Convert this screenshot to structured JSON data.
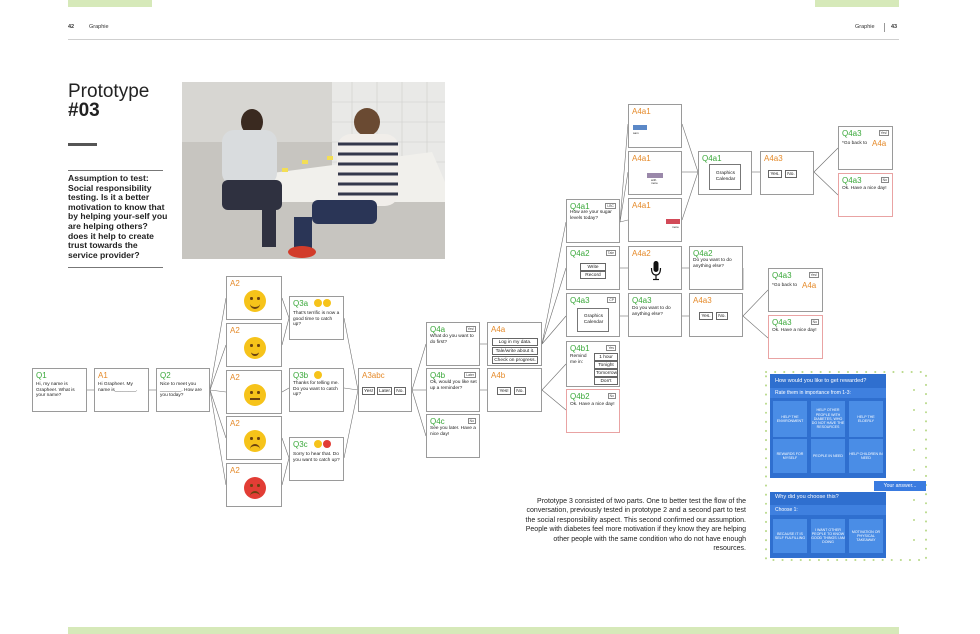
{
  "header": {
    "left_page_num": "42",
    "left_section": "Graphie",
    "right_section": "Graphie",
    "right_page_num": "43"
  },
  "prototype": {
    "title_line1": "Prototype",
    "title_line2": "#03",
    "assumption": "Assumption to test: Social responsibility testing. Is it a better motivation to know that by helping your-self you are helping others? does it help to create trust towards the service provider?"
  },
  "description": "Prototype 3 consisted of two parts. One to better test the flow of the conversation, previously tested in prototype 2 and a second part to test the social responsibility aspect. This second confirmed our assumption. People with diabetes feel more motivation if they know they are helping other people with the same condition who do not have enough resources.",
  "flow": {
    "q1": {
      "label": "Q1",
      "text": "Hi, my name is Graphee!. What is your name?"
    },
    "a1": {
      "label": "A1",
      "text": "Hi Graphee!. My name is________."
    },
    "q2": {
      "label": "Q2",
      "text": "Nice to meet you ________. How are you today?"
    },
    "a2": [
      "A2",
      "A2",
      "A2",
      "A2",
      "A2"
    ],
    "q3a": {
      "label": "Q3a",
      "text": "That's terrific is now a good time to catch up?"
    },
    "q3b": {
      "label": "Q3b",
      "text": "Thanks for telling me. Do you want to catch up?"
    },
    "q3c": {
      "label": "Q3c",
      "text": "Sorry to hear that. Do you want to catch up?"
    },
    "a3abc": {
      "label": "A3abc",
      "buttons": [
        "Yes!",
        "Later.",
        "No."
      ]
    },
    "q4a": {
      "label": "Q4a",
      "tag": "Yes!",
      "text": "What do you want to do first?"
    },
    "q4b": {
      "label": "Q4b",
      "tag": "Later",
      "text": "Ok, would you like set up a reminder?"
    },
    "q4c": {
      "label": "Q4c",
      "tag": "No",
      "text": "See you later. Have a nice day!"
    },
    "a4a": {
      "label": "A4a",
      "buttons": [
        "Log in my data.",
        "Tale/write about it.",
        "Check on progress."
      ]
    },
    "a4b": {
      "label": "A4b",
      "buttons": [
        "Yes!",
        "No."
      ]
    },
    "q4a1": {
      "label": "Q4a1",
      "tag": "LBC",
      "text": "How are your sugar levels today?"
    },
    "q4a2": {
      "label": "Q4a2",
      "tag": "Tale",
      "buttons": [
        "Write",
        "Record"
      ]
    },
    "q4a3": {
      "label": "Q4a3",
      "tag": "CP",
      "text": "Graphics Calendar"
    },
    "q4b1": {
      "label": "Q4b1",
      "tag": "Yes",
      "text": "Remind me in:",
      "buttons": [
        "1 hour",
        "Tonight",
        "Tomorrow",
        "Don't"
      ]
    },
    "q4b2": {
      "label": "Q4b2",
      "tag": "No",
      "text": "Ok. Have a nice day!"
    },
    "a4a1": [
      "A4a1",
      "A4a1",
      "A4a1"
    ],
    "a4a1_small": [
      "sam",
      "with\nmore",
      "more"
    ],
    "q4a1b": {
      "label": "Q4a1",
      "text": "Graphics Calendar"
    },
    "a4a3_top": {
      "label": "A4a3",
      "buttons": [
        "Yes.",
        "No."
      ]
    },
    "a4a2": {
      "label": "A4a2"
    },
    "q4a2b": {
      "label": "Q4a2",
      "text": "Do you want to do anything else?"
    },
    "q4a3b": {
      "label": "Q4a3",
      "text": "Do you want to do anything else?"
    },
    "a4a3_mid": {
      "label": "A4a3",
      "buttons": [
        "Yes.",
        "No."
      ]
    },
    "end_top_yes": {
      "label": "Q4a3",
      "tag": "Yes!",
      "text": "*Go back to",
      "link": "A4a"
    },
    "end_top_no": {
      "label": "Q4a3",
      "tag": "No",
      "text": "Ok. Have a nice day!"
    },
    "end_mid_yes": {
      "label": "Q4a3",
      "tag": "Yes!",
      "text": "*Go back to",
      "link": "A4a"
    },
    "end_mid_no": {
      "label": "Q4a3",
      "tag": "No",
      "text": "Ok. Have a nice day!"
    }
  },
  "survey": {
    "title": "How would you like to get rewarded?",
    "rate_title": "Rate them in importance from 1-3:",
    "options": [
      "HELP THE ENVIRONMENT",
      "HELP OTHER PEOPLE WITH DIABETES, WHO DO NOT HAVE THE RESOURCES",
      "HELP THE ELDERLY",
      "REWARDS FOR MYSELF",
      "PEOPLE IN NEED",
      "HELP CHILDREN IN NEED"
    ],
    "answer": "Your answer...",
    "why_title": "Why did you choose this?",
    "choose": "Choose 1:",
    "why_options": [
      "BECAUSE IT IS SELF FULFILLING",
      "I WANT OTHER PEOPLE TO KNOW GOOD THINGS I AM DOING",
      "MOTIVATION OR PHYSICAL TAKEAWAY"
    ]
  },
  "colors": {
    "green": "#3aa83a",
    "orange": "#e58a2a",
    "survey_blue": "#2f6fcf",
    "bar_green": "#d6e9b9"
  }
}
